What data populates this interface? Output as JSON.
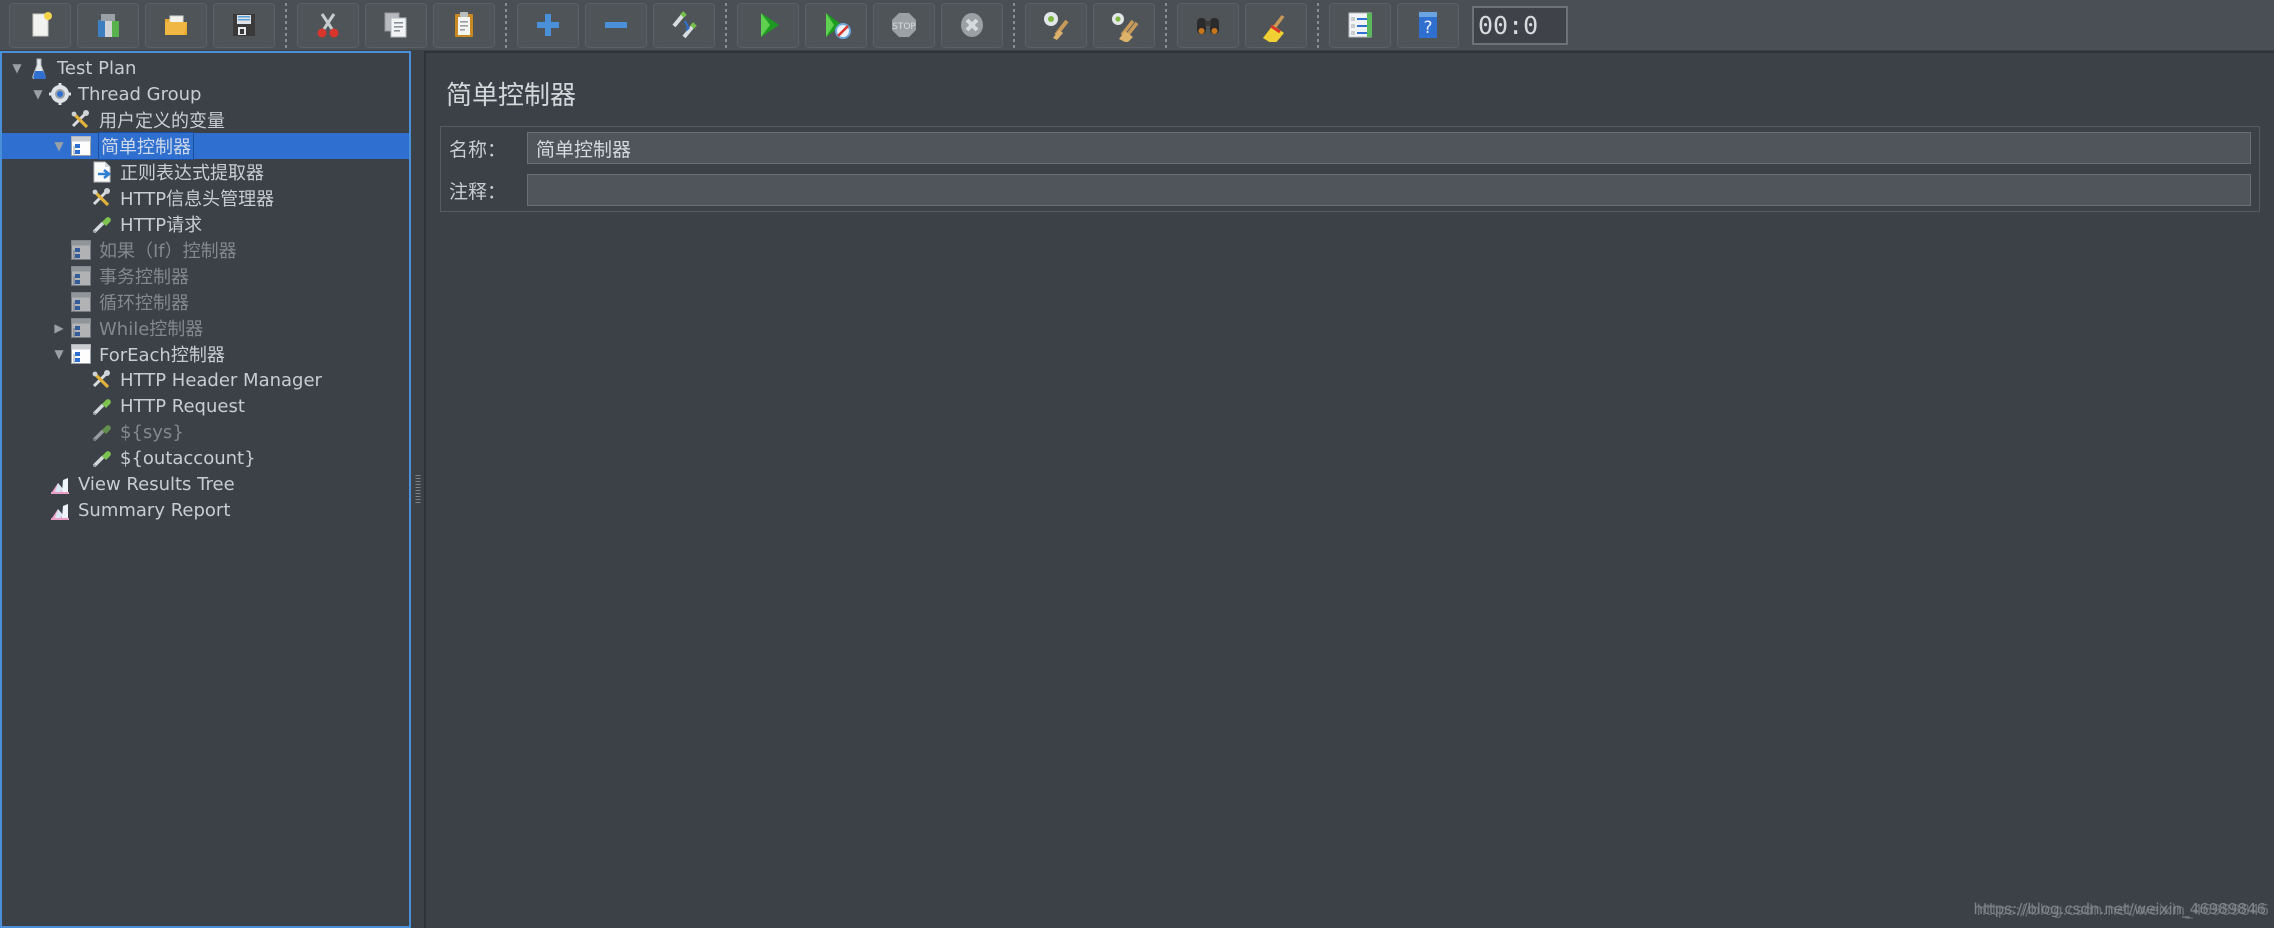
{
  "toolbar": {
    "buttons": [
      {
        "name": "new-button",
        "icon": "new-document-icon",
        "tooltip": "New"
      },
      {
        "name": "templates-button",
        "icon": "templates-books-icon",
        "tooltip": "Templates"
      },
      {
        "name": "open-button",
        "icon": "open-folder-icon",
        "tooltip": "Open"
      },
      {
        "name": "save-button",
        "icon": "save-floppy-icon",
        "tooltip": "Save Test Plan"
      },
      {
        "sep": true
      },
      {
        "name": "cut-button",
        "icon": "scissors-icon",
        "tooltip": "Cut"
      },
      {
        "name": "copy-button",
        "icon": "copy-pages-icon",
        "tooltip": "Copy"
      },
      {
        "name": "paste-button",
        "icon": "clipboard-icon",
        "tooltip": "Paste"
      },
      {
        "sep": true
      },
      {
        "name": "expand-all-button",
        "icon": "plus-icon",
        "tooltip": "Expand All"
      },
      {
        "name": "collapse-all-button",
        "icon": "minus-icon",
        "tooltip": "Collapse All"
      },
      {
        "name": "toggle-enable-button",
        "icon": "toggle-pencils-icon",
        "tooltip": "Toggle"
      },
      {
        "sep": true
      },
      {
        "name": "start-button",
        "icon": "play-green-icon",
        "tooltip": "Start"
      },
      {
        "name": "start-no-timers-button",
        "icon": "play-no-timers-icon",
        "tooltip": "Start no pauses"
      },
      {
        "name": "stop-button",
        "icon": "stop-sign-icon",
        "tooltip": "Stop"
      },
      {
        "name": "shutdown-button",
        "icon": "shutdown-x-icon",
        "tooltip": "Shutdown"
      },
      {
        "sep": true
      },
      {
        "name": "clear-button",
        "icon": "gear-broom-icon",
        "tooltip": "Clear"
      },
      {
        "name": "clear-all-button",
        "icon": "gear-brooms-icon",
        "tooltip": "Clear All"
      },
      {
        "sep": true
      },
      {
        "name": "search-button",
        "icon": "binoculars-icon",
        "tooltip": "Search"
      },
      {
        "name": "reset-search-button",
        "icon": "broom-yellow-icon",
        "tooltip": "Reset Search"
      },
      {
        "sep": true
      },
      {
        "name": "function-helper-button",
        "icon": "list-lines-icon",
        "tooltip": "Function Helper Dialog"
      },
      {
        "name": "help-button",
        "icon": "help-book-icon",
        "tooltip": "Help"
      }
    ],
    "timer": "00:0"
  },
  "tree": {
    "nodes": [
      {
        "label": "Test Plan",
        "icon": "flask-icon",
        "depth": 0,
        "twisty": "down",
        "selected": false,
        "disabled": false
      },
      {
        "label": "Thread Group",
        "icon": "gear-icon",
        "depth": 1,
        "twisty": "down",
        "selected": false,
        "disabled": false
      },
      {
        "label": "用户定义的变量",
        "icon": "wrench-icon",
        "depth": 2,
        "twisty": "none",
        "selected": false,
        "disabled": false
      },
      {
        "label": "简单控制器",
        "icon": "controller-icon",
        "depth": 2,
        "twisty": "down",
        "selected": true,
        "disabled": false
      },
      {
        "label": "正则表达式提取器",
        "icon": "regex-icon",
        "depth": 3,
        "twisty": "none",
        "selected": false,
        "disabled": false
      },
      {
        "label": "HTTP信息头管理器",
        "icon": "wrench-icon",
        "depth": 3,
        "twisty": "none",
        "selected": false,
        "disabled": false
      },
      {
        "label": "HTTP请求",
        "icon": "pipette-icon",
        "depth": 3,
        "twisty": "none",
        "selected": false,
        "disabled": false
      },
      {
        "label": "如果（If）控制器",
        "icon": "controller-icon",
        "depth": 2,
        "twisty": "none",
        "selected": false,
        "disabled": true
      },
      {
        "label": "事务控制器",
        "icon": "controller-icon",
        "depth": 2,
        "twisty": "none",
        "selected": false,
        "disabled": true
      },
      {
        "label": "循环控制器",
        "icon": "controller-icon",
        "depth": 2,
        "twisty": "none",
        "selected": false,
        "disabled": true
      },
      {
        "label": "While控制器",
        "icon": "controller-icon",
        "depth": 2,
        "twisty": "right",
        "selected": false,
        "disabled": true
      },
      {
        "label": "ForEach控制器",
        "icon": "controller-icon",
        "depth": 2,
        "twisty": "down",
        "selected": false,
        "disabled": false
      },
      {
        "label": "HTTP Header Manager",
        "icon": "wrench-icon",
        "depth": 3,
        "twisty": "none",
        "selected": false,
        "disabled": false
      },
      {
        "label": "HTTP Request",
        "icon": "pipette-icon",
        "depth": 3,
        "twisty": "none",
        "selected": false,
        "disabled": false
      },
      {
        "label": "${sys}",
        "icon": "pipette-icon",
        "depth": 3,
        "twisty": "none",
        "selected": false,
        "disabled": true
      },
      {
        "label": "${outaccount}",
        "icon": "pipette-icon",
        "depth": 3,
        "twisty": "none",
        "selected": false,
        "disabled": false
      },
      {
        "label": "View Results Tree",
        "icon": "chart-icon",
        "depth": 1,
        "twisty": "none",
        "selected": false,
        "disabled": false
      },
      {
        "label": "Summary Report",
        "icon": "chart-icon",
        "depth": 1,
        "twisty": "none",
        "selected": false,
        "disabled": false
      }
    ]
  },
  "detail": {
    "title": "简单控制器",
    "fields": {
      "name_label": "名称：",
      "name_value": "简单控制器",
      "comment_label": "注释：",
      "comment_value": ""
    }
  },
  "watermark": {
    "line_a": "https://blog.csdn.net/weixin_46989846",
    "line_b": "https://blog.csdn.net/weixin_46989846"
  },
  "colors": {
    "selection_blue": "#2f6fd0",
    "panel_bg": "#3c4147",
    "toolbar_bg": "#4a4f55",
    "focus_border": "#4a90d9",
    "text": "#c9cdd2",
    "text_disabled": "#83888e"
  }
}
